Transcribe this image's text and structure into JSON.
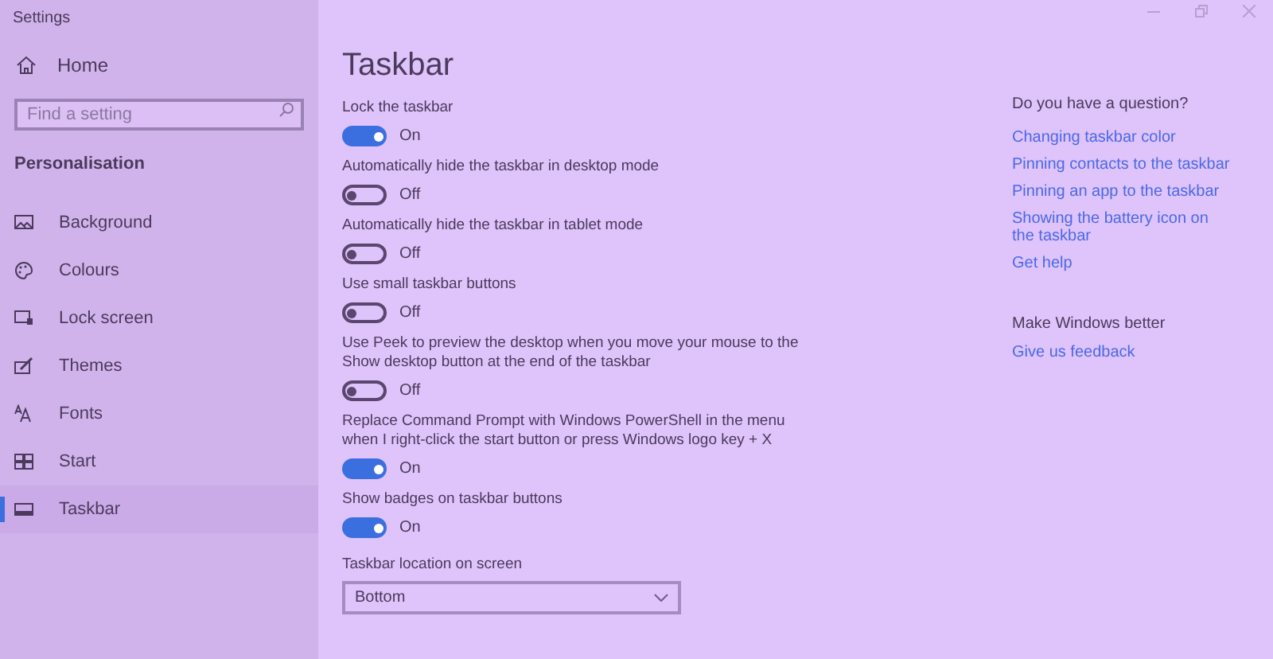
{
  "window": {
    "title": "Settings"
  },
  "sidebar": {
    "home": "Home",
    "search": {
      "placeholder": "Find a setting"
    },
    "section": "Personalisation",
    "items": [
      {
        "label": "Background",
        "kind": "background",
        "selected": false
      },
      {
        "label": "Colours",
        "kind": "colours",
        "selected": false
      },
      {
        "label": "Lock screen",
        "kind": "lock",
        "selected": false
      },
      {
        "label": "Themes",
        "kind": "themes",
        "selected": false
      },
      {
        "label": "Fonts",
        "kind": "fonts",
        "selected": false
      },
      {
        "label": "Start",
        "kind": "start",
        "selected": false
      },
      {
        "label": "Taskbar",
        "kind": "taskbar",
        "selected": true
      }
    ]
  },
  "page": {
    "title": "Taskbar",
    "settings": [
      {
        "label": "Lock the taskbar",
        "on": true,
        "state": "On"
      },
      {
        "label": "Automatically hide the taskbar in desktop mode",
        "on": false,
        "state": "Off"
      },
      {
        "label": "Automatically hide the taskbar in tablet mode",
        "on": false,
        "state": "Off"
      },
      {
        "label": "Use small taskbar buttons",
        "on": false,
        "state": "Off"
      },
      {
        "label": "Use Peek to preview the desktop when you move your mouse to the Show desktop button at the end of the taskbar",
        "on": false,
        "state": "Off"
      },
      {
        "label": "Replace Command Prompt with Windows PowerShell in the menu when I right-click the start button or press Windows logo key + X",
        "on": true,
        "state": "On"
      },
      {
        "label": "Show badges on taskbar buttons",
        "on": true,
        "state": "On"
      }
    ],
    "location": {
      "label": "Taskbar location on screen",
      "value": "Bottom"
    }
  },
  "help": {
    "heading": "Do you have a question?",
    "links": [
      "Changing taskbar color",
      "Pinning contacts to the taskbar",
      "Pinning an app to the taskbar",
      "Showing the battery icon on the taskbar",
      "Get help"
    ],
    "feedback_heading": "Make Windows better",
    "feedback_link": "Give us feedback"
  }
}
